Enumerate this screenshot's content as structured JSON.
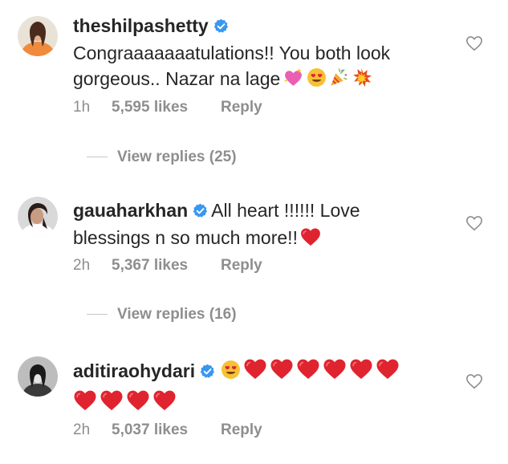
{
  "comments": [
    {
      "username": "theshilpashetty",
      "text_lines": [
        "Congraaaaaaatulations!! You both look",
        "gorgeous.. Nazar na lage"
      ],
      "time": "1h",
      "likes": "5,595 likes",
      "reply": "Reply",
      "view_replies": "View replies (25)",
      "emoji_icons": [
        "heart-sparkle-icon",
        "heart-eyes-icon",
        "party-popper-icon",
        "collision-icon"
      ]
    },
    {
      "username": "gauaharkhan",
      "text_lines": [
        "All heart !!!!!! Love",
        "blessings n so much more!!"
      ],
      "time": "2h",
      "likes": "5,367 likes",
      "reply": "Reply",
      "view_replies": "View replies (16)",
      "emoji_icons": [
        "red-heart-icon"
      ]
    },
    {
      "username": "aditiraohydari",
      "text_lines": [
        "",
        ""
      ],
      "time": "2h",
      "likes": "5,037 likes",
      "reply": "Reply",
      "emoji_icons": [
        "heart-eyes-icon",
        "red-heart-icon x9"
      ]
    }
  ],
  "colors": {
    "text": "#262626",
    "meta": "#8e8e8e",
    "verified": "#3897f0",
    "heart": "#e0242f"
  }
}
